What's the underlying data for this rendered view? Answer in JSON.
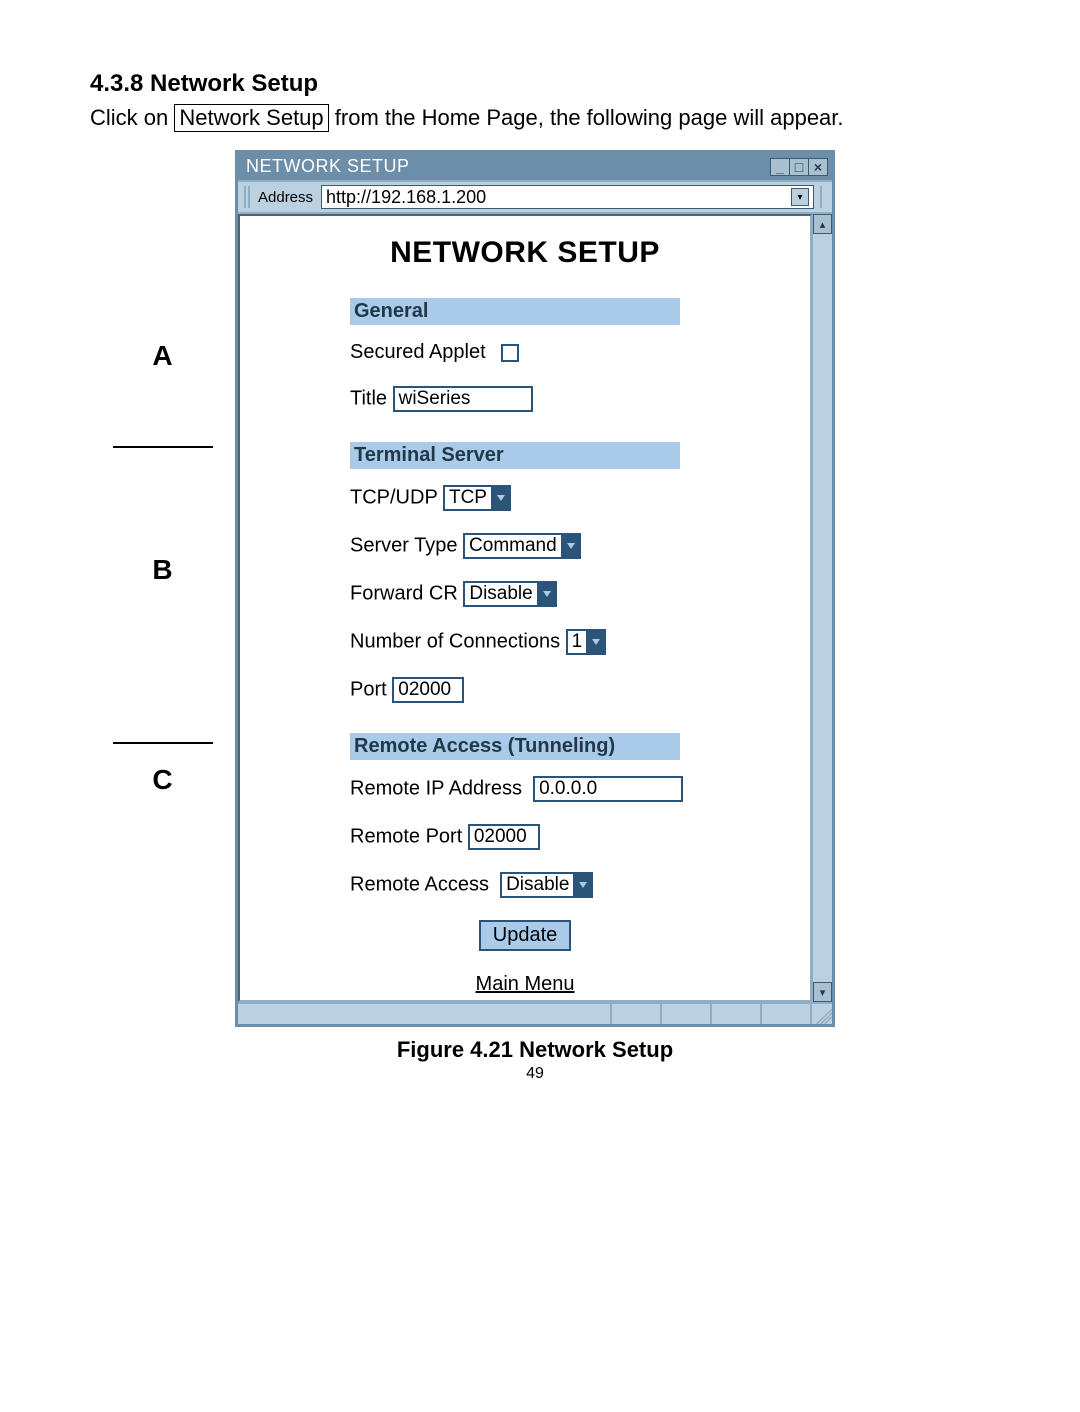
{
  "doc": {
    "heading": "4.3.8  Network Setup",
    "intro_pre": "Click on ",
    "intro_btn": "Network Setup",
    "intro_post": " from the Home Page, the following page will appear.",
    "figure_caption": "Figure 4.21  Network Setup",
    "page_number": "49"
  },
  "annotations": {
    "A": "A",
    "B": "B",
    "C": "C"
  },
  "window": {
    "title": "NETWORK SETUP",
    "address_label": "Address",
    "address": "http://192.168.1.200"
  },
  "page": {
    "title": "NETWORK SETUP",
    "sections": {
      "general": {
        "heading": "General",
        "secured_applet_label": "Secured Applet",
        "title_label": "Title",
        "title_value": "wiSeries"
      },
      "terminal": {
        "heading": "Terminal Server",
        "tcpudp_label": "TCP/UDP",
        "tcpudp_value": "TCP",
        "server_type_label": "Server Type",
        "server_type_value": "Command",
        "forward_cr_label": "Forward CR",
        "forward_cr_value": "Disable",
        "num_conn_label": "Number of Connections",
        "num_conn_value": "1",
        "port_label": "Port",
        "port_value": "02000"
      },
      "remote": {
        "heading": "Remote Access (Tunneling)",
        "ip_label": "Remote IP Address",
        "ip_value": "0.0.0.0",
        "port_label": "Remote Port",
        "port_value": "02000",
        "access_label": "Remote Access",
        "access_value": "Disable"
      }
    },
    "update_label": "Update",
    "main_menu_label": "Main Menu"
  }
}
